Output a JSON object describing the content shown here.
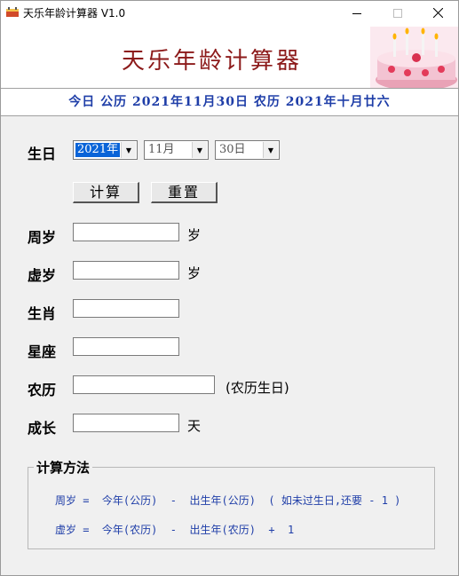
{
  "window": {
    "title": "天乐年龄计算器 V1.0",
    "controls": [
      "minimize",
      "maximize",
      "close"
    ]
  },
  "header": {
    "title": "天乐年龄计算器",
    "image": "birthday-cake"
  },
  "today": {
    "text": "今日  公历  2021年11月30日  农历  2021年十月廿六"
  },
  "birthday": {
    "label": "生日",
    "year": "2021年",
    "month": "11月",
    "day": "30日"
  },
  "buttons": {
    "calculate": "计算",
    "reset": "重置"
  },
  "results": {
    "full_age": {
      "label": "周岁",
      "value": "",
      "unit": "岁"
    },
    "nominal_age": {
      "label": "虚岁",
      "value": "",
      "unit": "岁"
    },
    "zodiac": {
      "label": "生肖",
      "value": ""
    },
    "constellation": {
      "label": "星座",
      "value": ""
    },
    "lunar": {
      "label": "农历",
      "value": "",
      "note": "(农历生日)"
    },
    "growth": {
      "label": "成长",
      "value": "",
      "unit": "天"
    }
  },
  "method": {
    "title": "计算方法",
    "line1": "周岁 =  今年(公历)  -  出生年(公历)  ( 如未过生日,还要 - 1 )",
    "line2": "虚岁 =  今年(农历)  -  出生年(农历)  +  1"
  },
  "colors": {
    "title_red": "#8c1a1a",
    "date_blue": "#1f3ea8",
    "selection": "#0a64d8"
  }
}
